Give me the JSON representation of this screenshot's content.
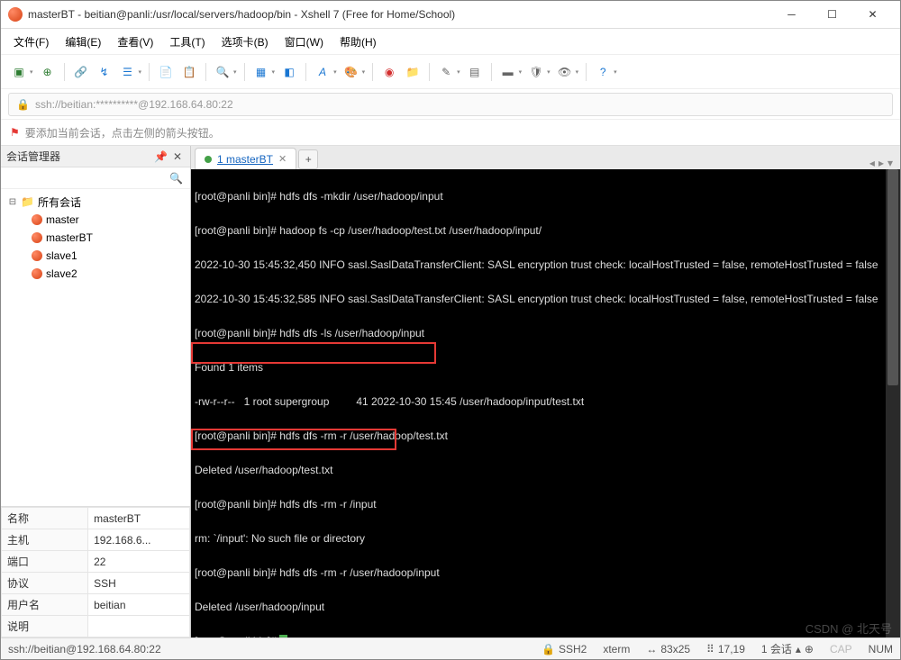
{
  "window": {
    "title": "masterBT - beitian@panli:/usr/local/servers/hadoop/bin - Xshell 7 (Free for Home/School)"
  },
  "menu": {
    "file": "文件(F)",
    "edit": "编辑(E)",
    "view": "查看(V)",
    "tools": "工具(T)",
    "tabs": "选项卡(B)",
    "window": "窗口(W)",
    "help": "帮助(H)"
  },
  "address": {
    "url": "ssh://beitian:**********@192.168.64.80:22"
  },
  "hint": {
    "text": "要添加当前会话，点击左侧的箭头按钮。"
  },
  "sidebar": {
    "title": "会话管理器",
    "root": "所有会话",
    "sessions": [
      "master",
      "masterBT",
      "slave1",
      "slave2"
    ]
  },
  "props": {
    "labels": {
      "name": "名称",
      "host": "主机",
      "port": "端口",
      "protocol": "协议",
      "user": "用户名",
      "desc": "说明"
    },
    "values": {
      "name": "masterBT",
      "host": "192.168.6...",
      "port": "22",
      "protocol": "SSH",
      "user": "beitian",
      "desc": ""
    }
  },
  "tab": {
    "title": "1 masterBT",
    "add": "+"
  },
  "terminal": {
    "l1": "[root@panli bin]# hdfs dfs -mkdir /user/hadoop/input",
    "l2": "[root@panli bin]# hadoop fs -cp /user/hadoop/test.txt /user/hadoop/input/",
    "l3": "2022-10-30 15:45:32,450 INFO sasl.SaslDataTransferClient: SASL encryption trust check: localHostTrusted = false, remoteHostTrusted = false",
    "l4": "2022-10-30 15:45:32,585 INFO sasl.SaslDataTransferClient: SASL encryption trust check: localHostTrusted = false, remoteHostTrusted = false",
    "l5": "[root@panli bin]# hdfs dfs -ls /user/hadoop/input",
    "l6": "Found 1 items",
    "l7": "-rw-r--r--   1 root supergroup         41 2022-10-30 15:45 /user/hadoop/input/test.txt",
    "l8": "[root@panli bin]# hdfs dfs -rm -r /user/hadoop/test.txt",
    "l9": "Deleted /user/hadoop/test.txt",
    "l10": "[root@panli bin]# hdfs dfs -rm -r /input",
    "l11": "rm: `/input': No such file or directory",
    "l12": "[root@panli bin]# hdfs dfs -rm -r /user/hadoop/input",
    "l13": "Deleted /user/hadoop/input",
    "l14": "[root@panli bin]# "
  },
  "status": {
    "conn": "ssh://beitian@192.168.64.80:22",
    "ssh": "SSH2",
    "term": "xterm",
    "size": "83x25",
    "pos": "17,19",
    "sessions": "1 会话",
    "cap": "CAP",
    "num": "NUM"
  },
  "watermark": "CSDN @ 北天号"
}
